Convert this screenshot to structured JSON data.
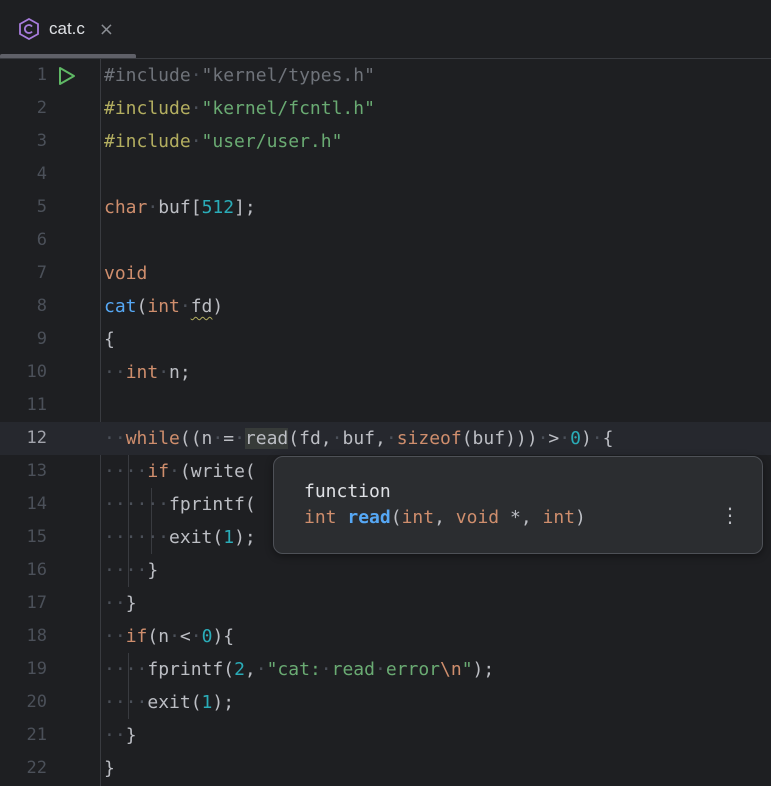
{
  "tab": {
    "filename": "cat.c",
    "file_icon": "c-language-icon",
    "close_icon": "close-icon",
    "close_glyph": "×"
  },
  "editor": {
    "current_line": 12,
    "lines": [
      {
        "n": "1"
      },
      {
        "n": "2"
      },
      {
        "n": "3"
      },
      {
        "n": "4"
      },
      {
        "n": "5"
      },
      {
        "n": "6"
      },
      {
        "n": "7"
      },
      {
        "n": "8"
      },
      {
        "n": "9"
      },
      {
        "n": "10"
      },
      {
        "n": "11"
      },
      {
        "n": "12"
      },
      {
        "n": "13"
      },
      {
        "n": "14"
      },
      {
        "n": "15"
      },
      {
        "n": "16"
      },
      {
        "n": "17"
      },
      {
        "n": "18"
      },
      {
        "n": "19"
      },
      {
        "n": "20"
      },
      {
        "n": "21"
      },
      {
        "n": "22"
      }
    ],
    "code": {
      "l1_directive": "#include",
      "l1_path": "\"kernel/types.h\"",
      "l2_directive": "#include",
      "l2_path": "\"kernel/fcntl.h\"",
      "l3_directive": "#include",
      "l3_path": "\"user/user.h\"",
      "l5_type": "char",
      "l5_name": "buf[",
      "l5_size": "512",
      "l5_end": "];",
      "l7_type": "void",
      "l8_fn": "cat",
      "l8_open": "(",
      "l8_type": "int",
      "l8_param": "fd",
      "l8_close": ")",
      "l9": "{",
      "l10_type": "int",
      "l10_rest": "n;",
      "l12_kw": "while",
      "l12_a": "((n",
      "l12_eq": "=",
      "l12_read": "read",
      "l12_b": "(fd,",
      "l12_c": "buf,",
      "l12_sizeof": "sizeof",
      "l12_d": "(buf)))",
      "l12_gt": ">",
      "l12_zero": "0",
      "l12_e": ")",
      "l12_brace": "{",
      "l13_kw": "if",
      "l13_rest": "(write(",
      "l14": "fprintf(",
      "l15_fn": "exit(",
      "l15_num": "1",
      "l15_end": ");",
      "l16": "}",
      "l17": "}",
      "l18_kw": "if",
      "l18_a": "(n",
      "l18_lt": "<",
      "l18_zero": "0",
      "l18_b": "){",
      "l19_fn": "fprintf(",
      "l19_num": "2",
      "l19_comma": ",",
      "l19_str1": "\"cat:",
      "l19_str2": "read",
      "l19_str3": "error",
      "l19_esc": "\\n",
      "l19_quote": "\"",
      "l19_end": ");",
      "l20_fn": "exit(",
      "l20_num": "1",
      "l20_end": ");",
      "l21": "}",
      "l22": "}"
    }
  },
  "popup": {
    "kind": "function",
    "ret_type": "int",
    "fn_name": "read",
    "open": "(",
    "p1": "int",
    "comma1": ", ",
    "p2": "void",
    "ptr": " *",
    "comma2": ", ",
    "p3": "int",
    "close": ")",
    "more_glyph": "⋮"
  },
  "colors": {
    "background": "#1e1f22",
    "keyword": "#cf8e6d",
    "function": "#56a8f5",
    "number": "#2aacb8",
    "string": "#6aab73",
    "preprocessor": "#b3ae60",
    "text": "#bcbec4"
  }
}
